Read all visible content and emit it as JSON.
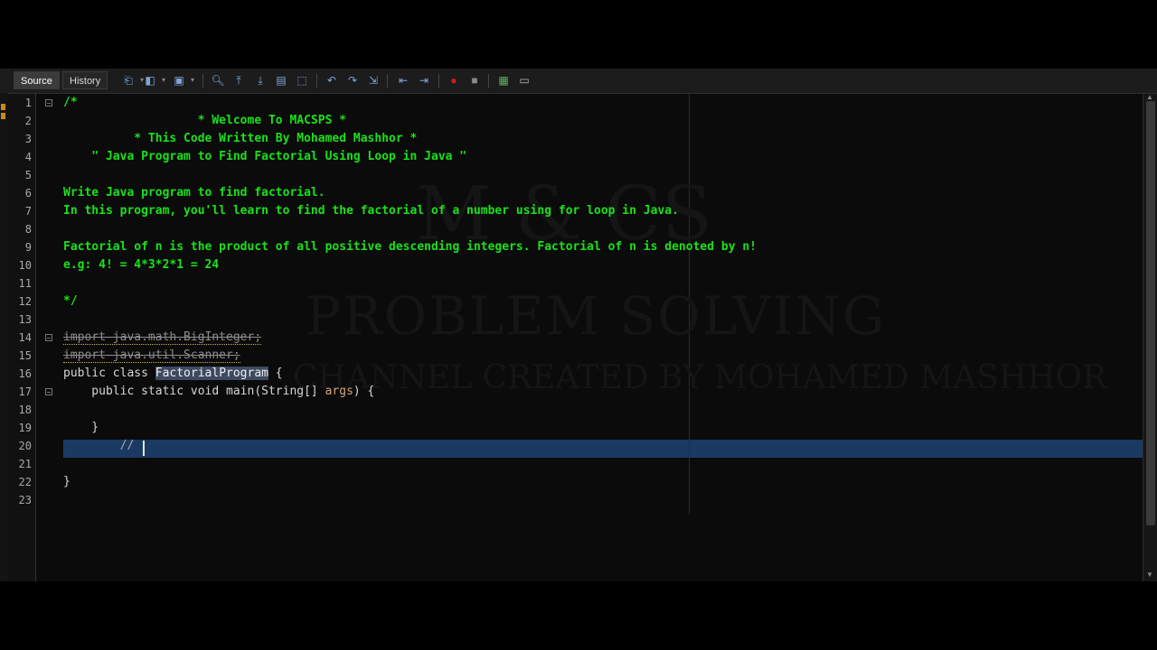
{
  "tabs": [
    {
      "label": "Source",
      "active": true
    },
    {
      "label": "History",
      "active": false
    }
  ],
  "toolbar_icons": [
    "last-edit-icon",
    "back-icon",
    "forward-icon",
    "find-icon",
    "find-prev-icon",
    "find-next-icon",
    "find-selection-icon",
    "toggle-highlight-icon",
    "prev-bookmark-icon",
    "next-bookmark-icon",
    "toggle-bookmark-icon",
    "shift-left-icon",
    "shift-right-icon",
    "start-macro-icon",
    "stop-macro-icon",
    "comment-icon",
    "uncomment-icon"
  ],
  "lines": [
    {
      "n": "1",
      "text": "/*"
    },
    {
      "n": "2",
      "text": "                   * Welcome To MACSPS *"
    },
    {
      "n": "3",
      "text": "          * This Code Written By Mohamed Mashhor *"
    },
    {
      "n": "4",
      "text": "    \" Java Program to Find Factorial Using Loop in Java \""
    },
    {
      "n": "5",
      "text": ""
    },
    {
      "n": "6",
      "text": "Write Java program to find factorial."
    },
    {
      "n": "7",
      "text": "In this program, you'll learn to find the factorial of a number using for loop in Java."
    },
    {
      "n": "8",
      "text": ""
    },
    {
      "n": "9",
      "text": "Factorial of n is the product of all positive descending integers. Factorial of n is denoted by n!"
    },
    {
      "n": "10",
      "text": "e.g: 4! = 4*3*2*1 = 24"
    },
    {
      "n": "11",
      "text": ""
    },
    {
      "n": "12",
      "text": "*/"
    },
    {
      "n": "13",
      "text": ""
    },
    {
      "n": "14",
      "text": "import java.math.BigInteger;"
    },
    {
      "n": "15",
      "text": "import java.util.Scanner;"
    },
    {
      "n": "16",
      "prefix": "public class ",
      "name": "FactorialProgram",
      "suffix": " {"
    },
    {
      "n": "17",
      "prefix": "    public static void main(String[] ",
      "param": "args",
      "suffix": ") {"
    },
    {
      "n": "18",
      "text": ""
    },
    {
      "n": "19",
      "text": "    }"
    },
    {
      "n": "20",
      "text": "        //"
    },
    {
      "n": "21",
      "text": ""
    },
    {
      "n": "22",
      "text": "}"
    },
    {
      "n": "23",
      "text": ""
    }
  ],
  "watermark": {
    "line1": "M & CS",
    "line2": "PROBLEM SOLVING",
    "line3": "CHANNEL CREATED BY MOHAMED MASHHOR"
  },
  "colors": {
    "comment": "#19e219",
    "current_line": "#1a3a62",
    "selection": "#3d4a60",
    "background": "#0b0b0b"
  }
}
